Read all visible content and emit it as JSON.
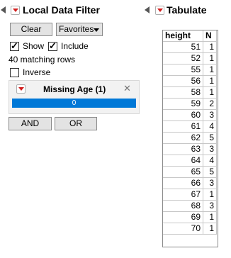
{
  "local_filter": {
    "title": "Local Data Filter",
    "clear_label": "Clear",
    "favorites_label": "Favorites",
    "show_label": "Show",
    "include_label": "Include",
    "matching_rows": "40 matching rows",
    "inverse_label": "Inverse",
    "filter_name": "Missing Age (1)",
    "bar_value": "0",
    "and_label": "AND",
    "or_label": "OR"
  },
  "tabulate": {
    "title": "Tabulate",
    "columns": [
      "height",
      "N"
    ],
    "rows": [
      [
        "51",
        "1"
      ],
      [
        "52",
        "1"
      ],
      [
        "55",
        "1"
      ],
      [
        "56",
        "1"
      ],
      [
        "58",
        "1"
      ],
      [
        "59",
        "2"
      ],
      [
        "60",
        "3"
      ],
      [
        "61",
        "4"
      ],
      [
        "62",
        "5"
      ],
      [
        "63",
        "3"
      ],
      [
        "64",
        "4"
      ],
      [
        "65",
        "5"
      ],
      [
        "66",
        "3"
      ],
      [
        "67",
        "1"
      ],
      [
        "68",
        "3"
      ],
      [
        "69",
        "1"
      ],
      [
        "70",
        "1"
      ]
    ]
  }
}
